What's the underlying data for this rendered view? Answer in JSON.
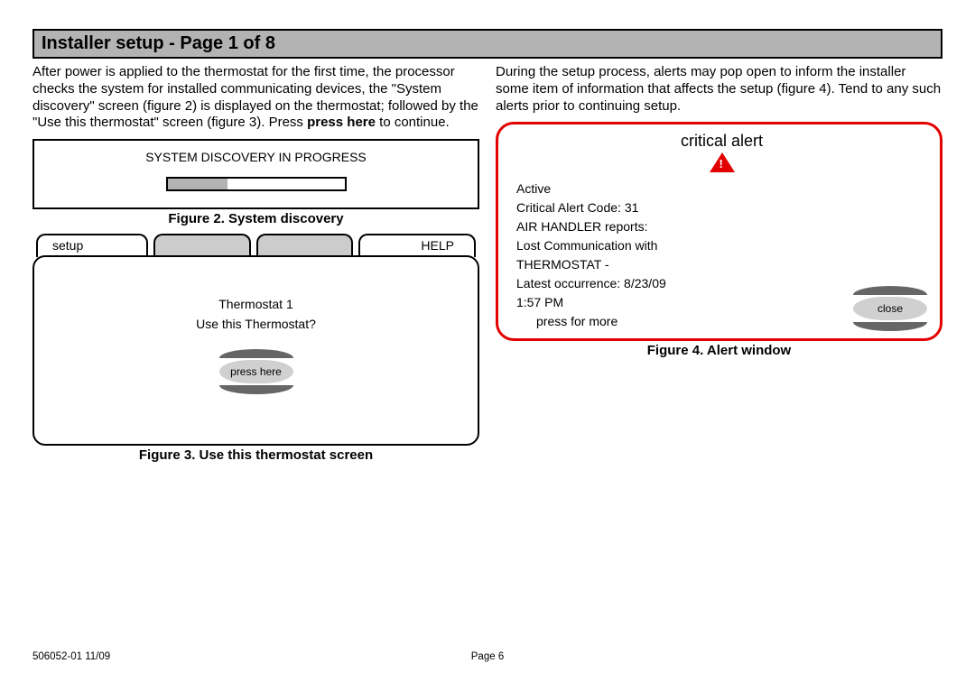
{
  "page_title": "Installer setup - Page 1 of 8",
  "left": {
    "paragraph_parts": [
      "After power is applied to the thermostat for the first time, the processor checks the system for installed communicating devices, the \"System discovery\" screen (figure 2) is displayed on the thermostat; followed by the \"Use this thermostat\" screen (figure 3).  Press ",
      "press here",
      " to continue."
    ],
    "fig2": {
      "title": "SYSTEM DISCOVERY IN PROGRESS",
      "caption": "Figure 2. System discovery",
      "progress_percent": 34
    },
    "fig3": {
      "tab_setup": "setup",
      "tab_help": "HELP",
      "line1": "Thermostat 1",
      "line2": "Use this Thermostat?",
      "button": "press here",
      "caption": "Figure 3. Use this thermostat screen"
    }
  },
  "right": {
    "paragraph": "During the setup process, alerts may pop open to inform the installer some item of information that affects the setup (figure 4). Tend to any such alerts prior to continuing setup.",
    "fig4": {
      "header": "critical alert",
      "lines": [
        "Active",
        "Critical Alert Code: 31",
        "AIR HANDLER reports:",
        "Lost Communication with",
        "THERMOSTAT -",
        "Latest occurrence: 8/23/09",
        "1:57 PM"
      ],
      "more": "press for more",
      "close": "close",
      "caption": "Figure 4. Alert window"
    }
  },
  "footer": {
    "left": "506052-01 11/09",
    "center": "Page 6"
  }
}
